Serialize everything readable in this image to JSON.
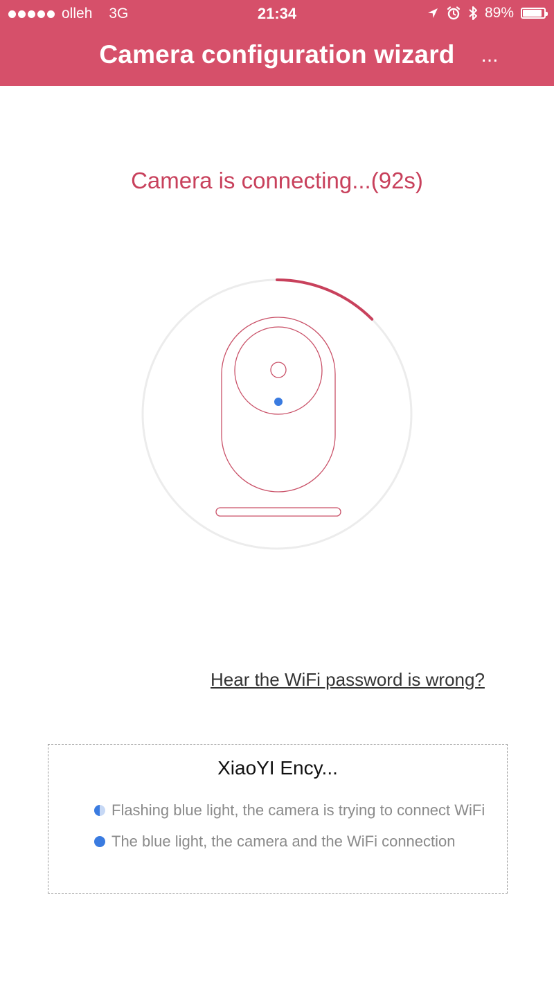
{
  "status_bar": {
    "carrier": "olleh",
    "network": "3G",
    "time": "21:34",
    "battery_percent": "89%",
    "battery_level": 0.89,
    "icons": [
      "location-arrow-icon",
      "alarm-icon",
      "bluetooth-icon"
    ]
  },
  "nav": {
    "title": "Camera configuration wizard",
    "more_label": "..."
  },
  "main": {
    "connecting_text": "Camera is connecting...(92s)",
    "progress_fraction": 0.125,
    "wifi_link": "Hear the WiFi password is wrong?"
  },
  "encyclopedia": {
    "title": "XiaoYI Ency...",
    "items": [
      {
        "icon": "half-blue-dot-icon",
        "text": "Flashing blue light, the camera is trying to connect WiFi"
      },
      {
        "icon": "blue-dot-icon",
        "text": "The blue light, the camera and the WiFi connection"
      }
    ]
  },
  "colors": {
    "header_bg": "#d6506a",
    "accent": "#c8415c",
    "outline": "#c95067",
    "ring": "#ececec",
    "indicator_blue": "#3a7be0"
  }
}
